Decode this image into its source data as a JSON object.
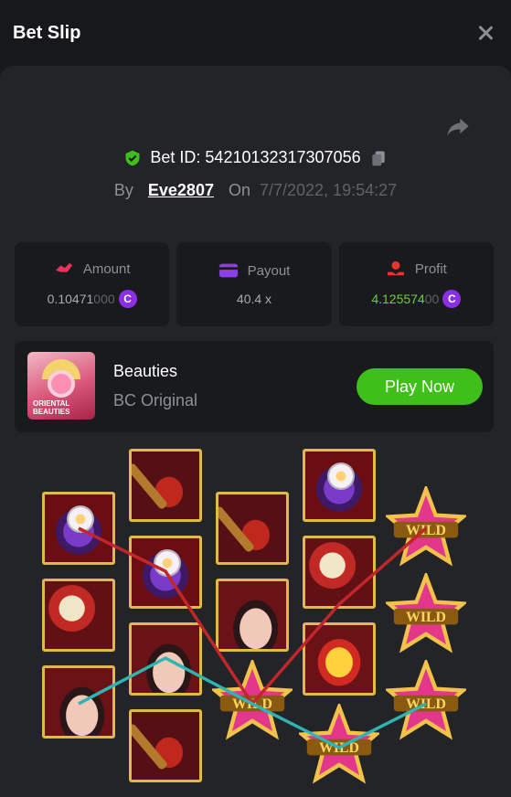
{
  "header": {
    "title": "Bet Slip"
  },
  "bet": {
    "id_label": "Bet ID:",
    "id_value": "54210132317307056",
    "by_label": "By",
    "user": "Eve2807",
    "on_label": "On",
    "datetime": "7/7/2022, 19:54:27"
  },
  "stats": {
    "amount": {
      "label": "Amount",
      "value_bright": "0.10471",
      "value_dim": "000"
    },
    "payout": {
      "label": "Payout",
      "value": "40.4 x"
    },
    "profit": {
      "label": "Profit",
      "value_bright": "4.125574",
      "value_dim": "00"
    }
  },
  "currency": {
    "symbol": "C",
    "color": "#8b2fe6"
  },
  "game": {
    "thumb_text_1": "ORIENTAL",
    "thumb_text_2": "BEAUTIES",
    "name": "Beauties",
    "provider": "BC Original",
    "play_label": "Play Now"
  },
  "reels": {
    "columns": [
      [
        "ring",
        "scroll",
        "lady"
      ],
      [
        "lute",
        "ring",
        "lady",
        "lute"
      ],
      [
        "lute",
        "lady",
        "wild"
      ],
      [
        "ring",
        "scroll",
        "gold",
        "wild"
      ],
      [
        "wild",
        "wild",
        "wild"
      ]
    ],
    "wild_label": "WILD",
    "paylines": [
      {
        "color": "#c0262a"
      },
      {
        "color": "#2fb4b4"
      }
    ]
  },
  "colors": {
    "accent_green": "#3fbf1a",
    "profit_green": "#6fce3a",
    "frame_gold": "#e1ba45"
  }
}
